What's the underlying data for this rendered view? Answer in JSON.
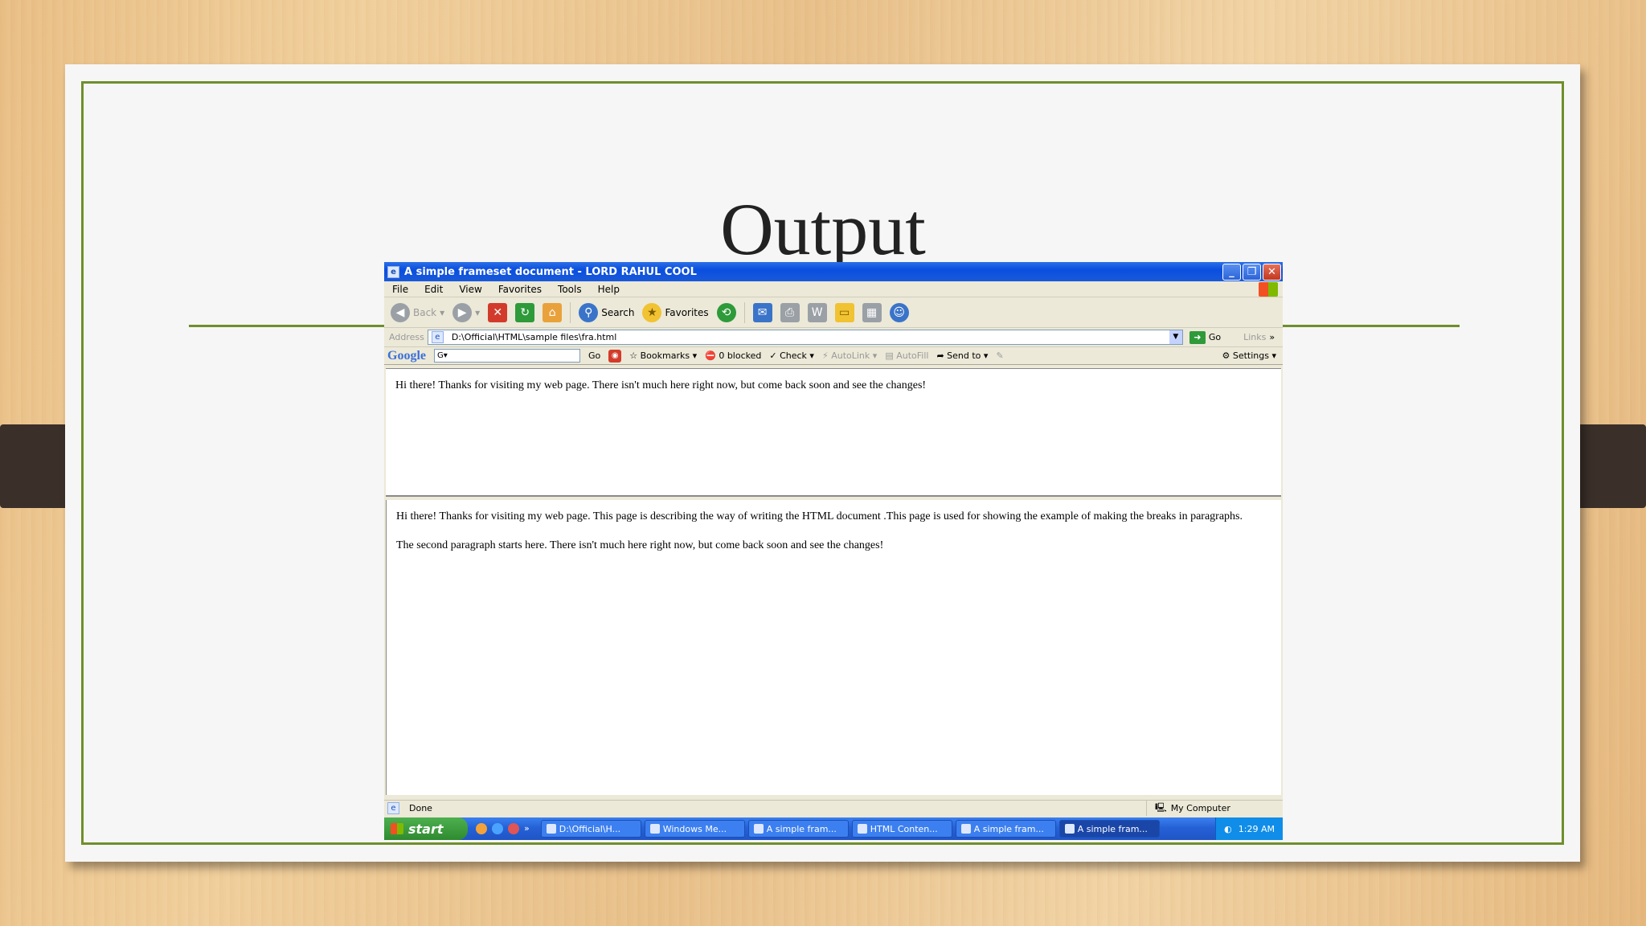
{
  "slide": {
    "title": "Output"
  },
  "browser": {
    "window_title": "A simple frameset document - LORD RAHUL COOL",
    "menu": [
      "File",
      "Edit",
      "View",
      "Favorites",
      "Tools",
      "Help"
    ],
    "toolbar": {
      "back": "Back",
      "search": "Search",
      "favorites": "Favorites"
    },
    "address": {
      "label": "Address",
      "value": "D:\\Official\\HTML\\sample files\\fra.html",
      "go": "Go",
      "links": "Links"
    },
    "googlebar": {
      "logo": "Google",
      "go": "Go",
      "bookmarks": "Bookmarks",
      "blocked": "0 blocked",
      "check": "Check",
      "autolink": "AutoLink",
      "autofill": "AutoFill",
      "sendto": "Send to",
      "settings": "Settings"
    },
    "frame_top_text": "Hi there! Thanks for visiting my web page. There isn't much here right now, but come back soon and see the changes!",
    "frame_bottom_para1": "Hi there! Thanks for visiting my web page. This page is describing the way of writing the HTML document .This page is used for showing the example of making the breaks in paragraphs.",
    "frame_bottom_para2": "The second paragraph starts here. There isn't much here right now, but come back soon and see the changes!",
    "status": {
      "text": "Done",
      "zone": "My Computer"
    }
  },
  "taskbar": {
    "start": "start",
    "tasks": [
      "D:\\Official\\H...",
      "Windows Me...",
      "A simple fram...",
      "HTML Conten...",
      "A simple fram...",
      "A simple fram..."
    ],
    "clock": "1:29 AM"
  }
}
